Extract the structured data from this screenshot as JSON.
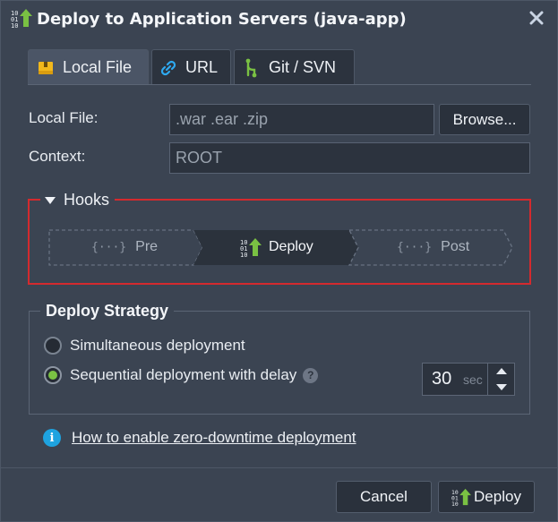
{
  "dialog": {
    "title": "Deploy to Application Servers (java-app)"
  },
  "tabs": [
    {
      "label": "Local File",
      "icon": "archive-icon",
      "active": true
    },
    {
      "label": "URL",
      "icon": "link-icon",
      "active": false
    },
    {
      "label": "Git / SVN",
      "icon": "git-branch-icon",
      "active": false
    }
  ],
  "form": {
    "local_file_label": "Local File:",
    "local_file_placeholder": ".war .ear .zip",
    "browse_label": "Browse...",
    "context_label": "Context:",
    "context_value": "ROOT"
  },
  "hooks": {
    "label": "Hooks",
    "expanded": true,
    "steps": [
      {
        "label": "Pre",
        "icon": "curly-braces-icon",
        "active": false
      },
      {
        "label": "Deploy",
        "icon": "deploy-icon",
        "active": true
      },
      {
        "label": "Post",
        "icon": "curly-braces-icon",
        "active": false
      }
    ],
    "curly": "{···}"
  },
  "strategy": {
    "title": "Deploy Strategy",
    "options": [
      {
        "label": "Simultaneous deployment",
        "checked": false
      },
      {
        "label": "Sequential deployment with delay",
        "checked": true
      }
    ],
    "help": "?",
    "delay_value": "30",
    "delay_unit": "sec"
  },
  "info": {
    "icon_glyph": "i",
    "link_text": "How to enable zero-downtime deployment"
  },
  "footer": {
    "cancel_label": "Cancel",
    "deploy_label": "Deploy"
  },
  "colors": {
    "background": "#3b4452",
    "accent_green": "#7ac143",
    "hooks_border": "#d42a2e",
    "info_blue": "#1ea3e0"
  }
}
